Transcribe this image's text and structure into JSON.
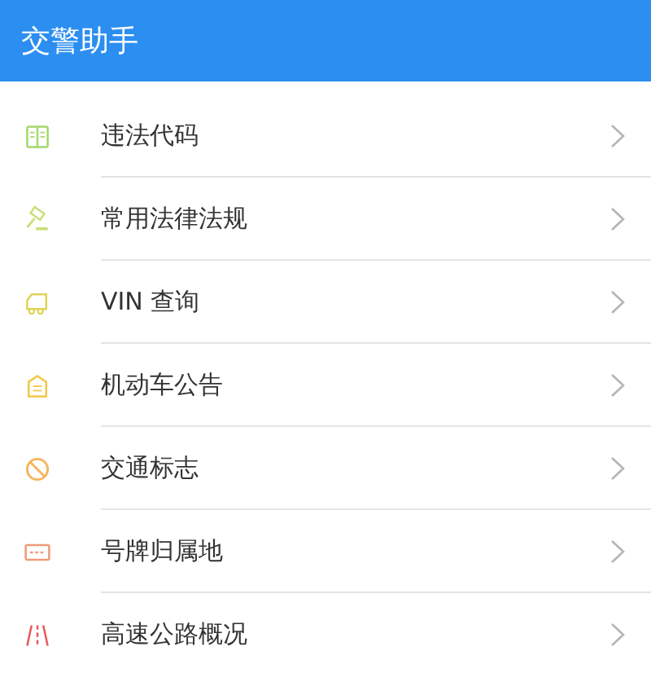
{
  "app_bar": {
    "title": "交警助手"
  },
  "menu": [
    {
      "label": "违法代码",
      "color": "#a5d86e"
    },
    {
      "label": "常用法律法规",
      "color": "#c8e07a"
    },
    {
      "label": "VIN 查询",
      "color": "#e0d35a"
    },
    {
      "label": "机动车公告",
      "color": "#f2c744"
    },
    {
      "label": "交通标志",
      "color": "#f5b55a"
    },
    {
      "label": "号牌归属地",
      "color": "#f09a78"
    },
    {
      "label": "高速公路概况",
      "color": "#e85a5a"
    }
  ]
}
